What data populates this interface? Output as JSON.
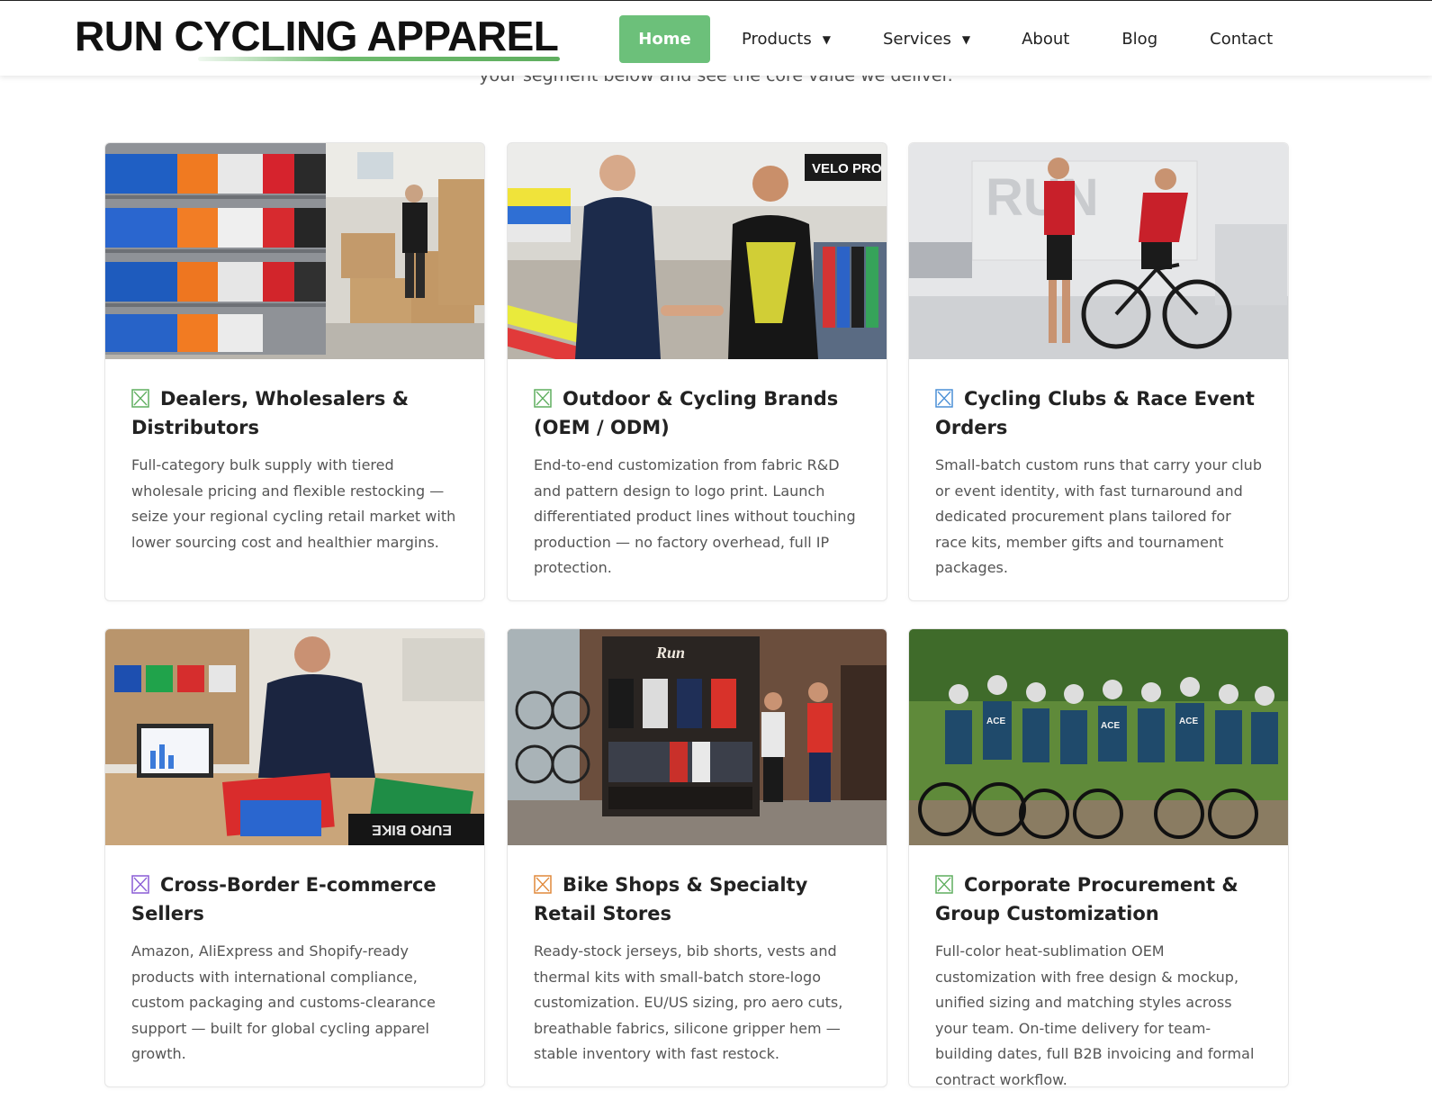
{
  "header": {
    "logo": "RUN CYCLING APPAREL",
    "nav": [
      {
        "label": "Home"
      },
      {
        "label": "Products"
      },
      {
        "label": "Services"
      },
      {
        "label": "About"
      },
      {
        "label": "Blog"
      },
      {
        "label": "Contact"
      }
    ],
    "accent_color": "#6cc07a"
  },
  "intro_fragment": "your segment below and see the core value we deliver.",
  "cards": [
    {
      "title": "Dealers, Wholesalers & Distributors",
      "icon": "checkbox-x-icon",
      "icon_color": "#5fae5f",
      "description": "Full-category bulk supply with tiered wholesale pricing and flexible restocking — seize your regional cycling retail market with lower sourcing cost and healthier margins."
    },
    {
      "title": "Outdoor & Cycling Brands (OEM / ODM)",
      "icon": "checkbox-x-icon",
      "icon_color": "#5fae5f",
      "description": "End-to-end customization from fabric R&D and pattern design to logo print. Launch differentiated product lines without touching production — no factory overhead, full IP protection."
    },
    {
      "title": "Cycling Clubs & Race Event Orders",
      "icon": "checkbox-x-icon",
      "icon_color": "#4a8fd6",
      "description": "Small-batch custom runs that carry your club or event identity, with fast turnaround and dedicated procurement plans tailored for race kits, member gifts and tournament packages."
    },
    {
      "title": "Cross-Border E-commerce Sellers",
      "icon": "checkbox-x-icon",
      "icon_color": "#8a5cd6",
      "description": "Amazon, AliExpress and Shopify-ready products with international compliance, custom packaging and customs-clearance support — built for global cycling apparel growth."
    },
    {
      "title": "Bike Shops & Specialty Retail Stores",
      "icon": "checkbox-x-icon",
      "icon_color": "#e0893a",
      "description": "Ready-stock jerseys, bib shorts, vests and thermal kits with small-batch store-logo customization. EU/US sizing, pro aero cuts, breathable fabrics, silicone gripper hem — stable inventory with fast restock."
    },
    {
      "title": "Corporate Procurement & Group Customization",
      "icon": "checkbox-x-icon",
      "icon_color": "#5fae5f",
      "description": "Full-color heat-sublimation OEM customization with free design & mockup, unified sizing and matching styles across your team. On-time delivery for team-building dates, full B2B invoicing and formal contract workflow."
    }
  ],
  "images": {
    "warehouse_sign": "",
    "velo_pro_sign": "VELO PRO",
    "run_store_sign": "Run",
    "ace_team_text": "ACE"
  }
}
